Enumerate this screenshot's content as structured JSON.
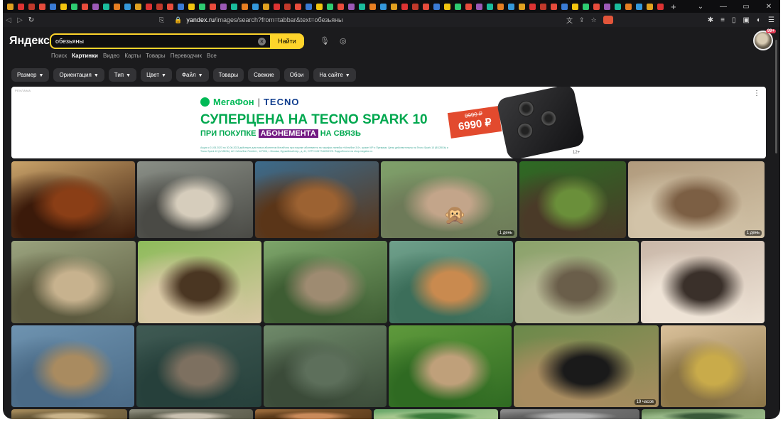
{
  "browser": {
    "tabs_count": 64,
    "url_host": "yandex.ru",
    "url_path": "/images/search?from=tabbar&text=обезьяны",
    "new_tab": "+"
  },
  "yandex": {
    "logo": "Яндекс",
    "search_value": "обезьяны",
    "search_button": "Найти",
    "services": [
      "Поиск",
      "Картинки",
      "Видео",
      "Карты",
      "Товары",
      "Переводчик",
      "Все"
    ],
    "active_service": "Картинки",
    "avatar_badge": "99+"
  },
  "filters": [
    {
      "label": "Размер",
      "dropdown": true
    },
    {
      "label": "Ориентация",
      "dropdown": true
    },
    {
      "label": "Тип",
      "dropdown": true
    },
    {
      "label": "Цвет",
      "dropdown": true
    },
    {
      "label": "Файл",
      "dropdown": true
    },
    {
      "label": "Товары",
      "dropdown": false
    },
    {
      "label": "Свежие",
      "dropdown": false
    },
    {
      "label": "Обои",
      "dropdown": false
    },
    {
      "label": "На сайте",
      "dropdown": true
    }
  ],
  "ad": {
    "mark": "РЕКЛАМА",
    "brand": "МегаФон",
    "partner": "TECNO",
    "headline": "СУПЕРЦЕНА НА TECNO SPARK 10",
    "subline_pre": "ПРИ ПОКУПКЕ",
    "subline_highlight": "АБОНЕМЕНТА",
    "subline_post": "НА СВЯЗЬ",
    "fineprint": "Акция с 01.05.2023 по 30.06.2023 действует для новых абонентов МегаФона при покупке абонемента на тарифах линейки «МегаФон 3.0», кроме VIP и Премиум. Цены действительны на Tecno Spark 10 (8/128Gb) и Tecno Spark 10 (4/128Gb). АО «МегаФон Ритейл», 127006, г. Москва, Оружейный пер., д. 41, ОГРН 1067746253725. Подробности на shop.megafon.ru",
    "old_price": "9990 ₽",
    "new_price": "6990 ₽",
    "age": "12+"
  },
  "images": [
    [
      {
        "w": 174,
        "colors": [
          "#c9a36a",
          "#8a3e16",
          "#3b1a0a"
        ],
        "badge": ""
      },
      {
        "w": 163,
        "colors": [
          "#8a8f87",
          "#d6cdbc",
          "#4a4a45"
        ],
        "badge": ""
      },
      {
        "w": 174,
        "colors": [
          "#3c6b8c",
          "#9c6232",
          "#5a3518"
        ],
        "badge": ""
      },
      {
        "w": 192,
        "colors": [
          "#7fa06a",
          "#c3a58a",
          "#6d7a58"
        ],
        "badge": "1 день",
        "emoji": "🙊"
      },
      {
        "w": 150,
        "colors": [
          "#2d6b24",
          "#6a8f3a",
          "#4a3a28"
        ],
        "badge": ""
      },
      {
        "w": 192,
        "colors": [
          "#b09a7c",
          "#7c5f44",
          "#d2c3a8"
        ],
        "badge": "1 день"
      }
    ],
    [
      {
        "w": 175,
        "colors": [
          "#9aa37e",
          "#c7b28e",
          "#5c5a3f"
        ],
        "badge": ""
      },
      {
        "w": 174,
        "colors": [
          "#8dbb5a",
          "#4a3622",
          "#d9c8a5"
        ],
        "badge": ""
      },
      {
        "w": 174,
        "colors": [
          "#7da56a",
          "#9e8b71",
          "#3e5d33"
        ],
        "badge": ""
      },
      {
        "w": 174,
        "colors": [
          "#6fa08b",
          "#c98a4f",
          "#3c6e5a"
        ],
        "badge": ""
      },
      {
        "w": 174,
        "colors": [
          "#8aa26a",
          "#6a5e4a",
          "#b5b592"
        ],
        "badge": ""
      },
      {
        "w": 174,
        "colors": [
          "#c9b7a8",
          "#3a302a",
          "#eee3d6"
        ],
        "badge": ""
      }
    ],
    [
      {
        "w": 173,
        "colors": [
          "#6e93b0",
          "#a98b60",
          "#4a6a86"
        ],
        "badge": ""
      },
      {
        "w": 176,
        "colors": [
          "#3f5a53",
          "#7d7060",
          "#26403b"
        ],
        "badge": ""
      },
      {
        "w": 173,
        "colors": [
          "#6f8a6a",
          "#5d6f5b",
          "#3b4b39"
        ],
        "badge": ""
      },
      {
        "w": 173,
        "colors": [
          "#5f9a3c",
          "#bfa07a",
          "#2f6a22"
        ],
        "badge": ""
      },
      {
        "w": 204,
        "colors": [
          "#6a8a4a",
          "#1a1a1a",
          "#a88c60"
        ],
        "badge": "19 часов"
      },
      {
        "w": 148,
        "colors": [
          "#d9c09a",
          "#c9ab4a",
          "#8a7446"
        ],
        "badge": ""
      }
    ],
    [
      {
        "w": 163,
        "colors": [
          "#a58a5a",
          "#c9b38a",
          "#6a5a3a"
        ],
        "badge": ""
      },
      {
        "w": 174,
        "colors": [
          "#8a8a7a",
          "#c9c0b0",
          "#5a5a4a"
        ],
        "badge": ""
      },
      {
        "w": 164,
        "colors": [
          "#9a6a3a",
          "#c98a5a",
          "#5a3a1a"
        ],
        "badge": ""
      },
      {
        "w": 175,
        "colors": [
          "#6aa86a",
          "#3a7a3a",
          "#a8c890"
        ],
        "badge": ""
      },
      {
        "w": 196,
        "colors": [
          "#8a8a8a",
          "#b0b0b0",
          "#606060"
        ],
        "badge": ""
      },
      {
        "w": 174,
        "colors": [
          "#6a8a5a",
          "#3a5a3a",
          "#9aba8a"
        ],
        "badge": ""
      }
    ]
  ]
}
